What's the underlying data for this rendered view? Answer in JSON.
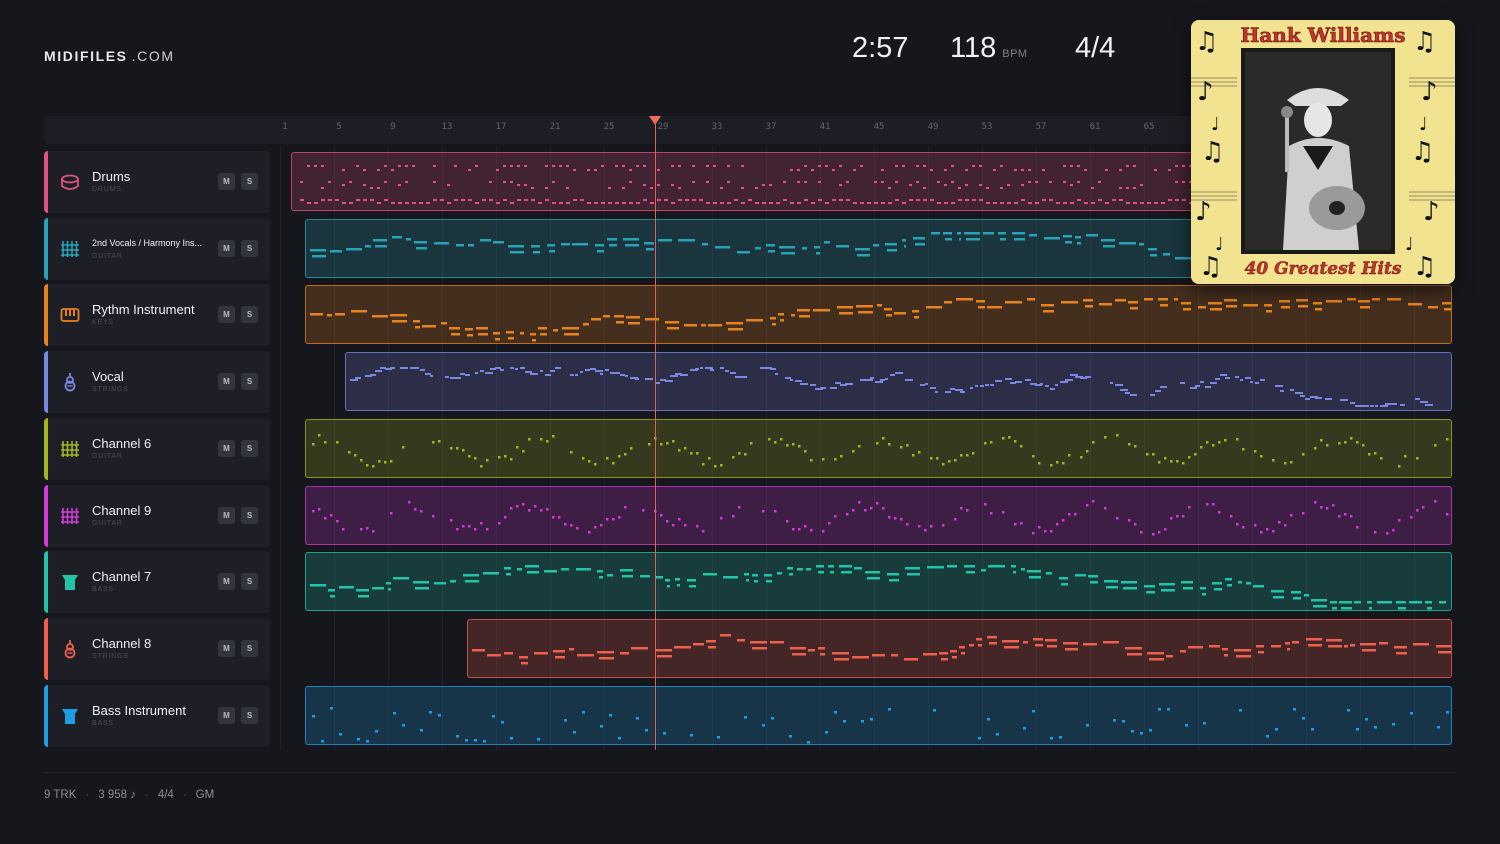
{
  "brand": {
    "name": "MIDIFILES",
    "suffix": ".COM"
  },
  "stats": {
    "duration": "2:57",
    "tempo": "118",
    "tempo_unit": "BPM",
    "time_signature": "4/4"
  },
  "ruler": {
    "ticks": [
      "1",
      "5",
      "9",
      "13",
      "17",
      "21",
      "25",
      "29",
      "33",
      "37",
      "41",
      "45",
      "49",
      "53",
      "57",
      "61",
      "65"
    ],
    "playhead_bar": 29
  },
  "track_controls": {
    "mute": "M",
    "solo": "S"
  },
  "tracks": [
    {
      "name": "Drums",
      "type": "DRUMS",
      "color": "#e0527f",
      "icon": "drum-icon",
      "style": "drum",
      "region_start_bar": 1
    },
    {
      "name": "2nd Vocals / Harmony Ins...",
      "type": "GUITAR",
      "color": "#27a3b5",
      "icon": "guitar-grid-icon",
      "style": "dash",
      "region_start_bar": 2
    },
    {
      "name": "Rythm Instrument",
      "type": "KEYS",
      "color": "#e8821e",
      "icon": "keys-icon",
      "style": "dash",
      "region_start_bar": 2
    },
    {
      "name": "Vocal",
      "type": "STRINGS",
      "color": "#7b86e0",
      "icon": "violin-icon",
      "style": "line",
      "region_start_bar": 5
    },
    {
      "name": "Channel 6",
      "type": "GUITAR",
      "color": "#a3b622",
      "icon": "guitar-grid-icon",
      "style": "dots",
      "region_start_bar": 2
    },
    {
      "name": "Channel 9",
      "type": "GUITAR",
      "color": "#d23bd6",
      "icon": "guitar-grid-icon",
      "style": "dots",
      "region_start_bar": 2
    },
    {
      "name": "Channel 7",
      "type": "BASS",
      "color": "#22c4a8",
      "icon": "bass-icon",
      "style": "dash",
      "region_start_bar": 2
    },
    {
      "name": "Channel 8",
      "type": "STRINGS",
      "color": "#ee5f4d",
      "icon": "violin-icon",
      "style": "dash",
      "region_start_bar": 14
    },
    {
      "name": "Bass Instrument",
      "type": "BASS",
      "color": "#1d9ee3",
      "icon": "bass-icon",
      "style": "sparse",
      "region_start_bar": 2
    }
  ],
  "album": {
    "artist": "Hank Williams",
    "title": "40 Greatest Hits"
  },
  "footer": {
    "tracks": "9 TRK",
    "notes": "3 958 ♪",
    "meter": "4/4",
    "standard": "GM"
  }
}
